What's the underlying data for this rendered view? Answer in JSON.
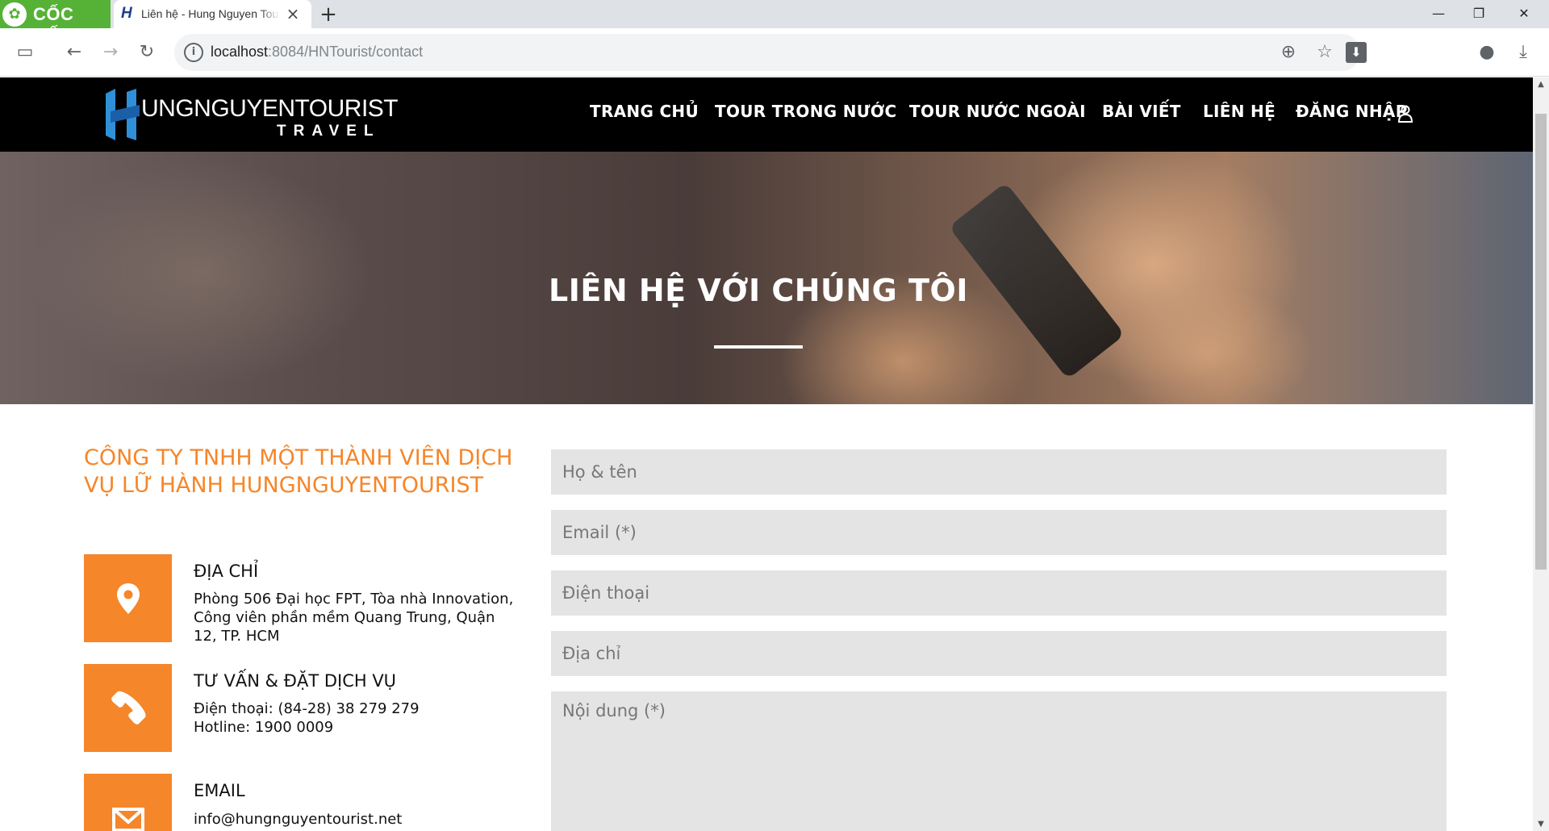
{
  "browser": {
    "brand": "CỐC CỐC",
    "tab_title": "Liên hệ - Hung Nguyen Tourist",
    "tab_close": "×",
    "new_tab": "+",
    "url_host": "localhost",
    "url_path": ":8084/HNTourist/contact"
  },
  "site": {
    "logo_word": "UNGNGUYENTOURIST",
    "logo_sub": "TRAVEL",
    "nav": [
      "TRANG CHỦ",
      "TOUR TRONG NƯỚC",
      "TOUR NƯỚC NGOÀI",
      "BÀI VIẾT",
      "LIÊN HỆ",
      "ĐĂNG NHẬP"
    ],
    "accent_color": "#f5862a"
  },
  "hero": {
    "title": "LIÊN HỆ VỚI CHÚNG TÔI"
  },
  "contact": {
    "company_name": "CÔNG TY TNHH MỘT THÀNH VIÊN DỊCH VỤ LỮ HÀNH HUNGNGUYENTOURIST",
    "address_heading": "ĐỊA CHỈ",
    "address_text": "Phòng 506 Đại học FPT, Tòa nhà Innovation, Công viên phần mềm Quang Trung, Quận 12, TP. HCM",
    "service_heading": "TƯ VẤN & ĐẶT DỊCH VỤ",
    "phone_text": "Điện thoại: (84-28) 38 279 279",
    "hotline_text": "Hotline: 1900 0009",
    "email_heading": "EMAIL",
    "email_text": "info@hungnguyentourist.net"
  },
  "form": {
    "name_placeholder": "Họ & tên",
    "email_placeholder": "Email (*)",
    "phone_placeholder": "Điện thoại",
    "address_placeholder": "Địa chỉ",
    "message_placeholder": "Nội dung (*)"
  }
}
